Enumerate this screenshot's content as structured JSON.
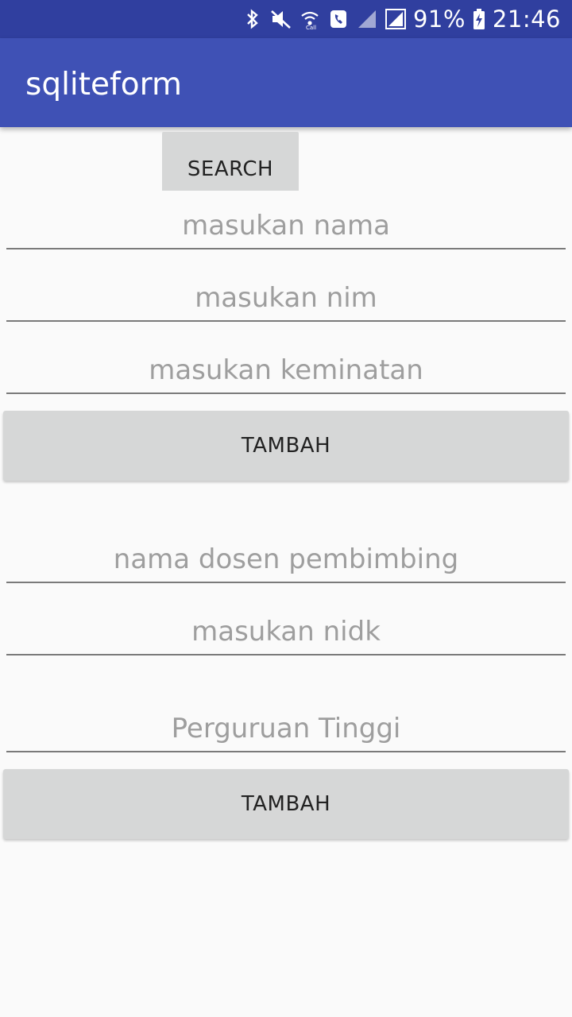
{
  "status_bar": {
    "battery": "91%",
    "time": "21:46",
    "icons": [
      "bluetooth-icon",
      "mute-icon",
      "wifi-call-icon",
      "phone-icon",
      "signal-icon",
      "signal-icon",
      "battery-charging-icon"
    ]
  },
  "app_bar": {
    "title": "sqliteform"
  },
  "form1": {
    "search_label": "SEARCH",
    "nama_placeholder": "masukan nama",
    "nim_placeholder": "masukan nim",
    "keminatan_placeholder": "masukan keminatan",
    "submit_label": "TAMBAH"
  },
  "form2": {
    "dosen_placeholder": "nama dosen pembimbing",
    "nidk_placeholder": "masukan nidk",
    "pt_placeholder": "Perguruan Tinggi",
    "submit_label": "TAMBAH"
  },
  "colors": {
    "primary": "#3f51b5",
    "primary_dark": "#303f9f",
    "button": "#d6d7d7"
  }
}
